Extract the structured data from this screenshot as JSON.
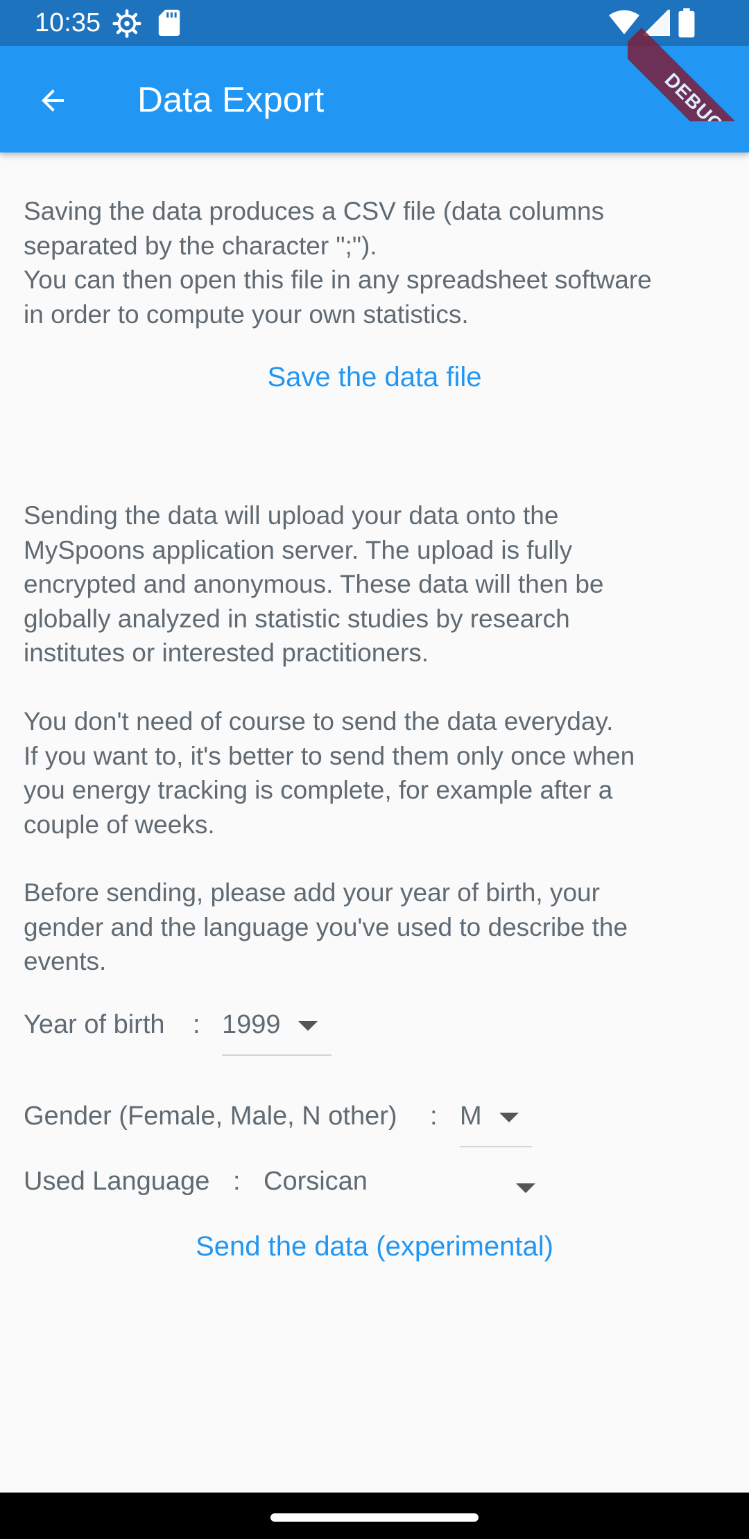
{
  "status_bar": {
    "time": "10:35",
    "icons": [
      "settings-gear-icon",
      "sd-card-icon",
      "wifi-icon",
      "signal-icon",
      "battery-icon"
    ]
  },
  "app_bar": {
    "back_icon": "arrow-back-icon",
    "title": "Data Export"
  },
  "debug_banner": "DEBUG",
  "intro": {
    "text": "Saving the data produces a CSV file (data columns\nseparated by the character \";\").\nYou can then open this file in any spreadsheet software\nin order to compute your own statistics."
  },
  "save_button": {
    "label": "Save the data file"
  },
  "sending": {
    "paragraph1": "Sending the data will upload your data onto the\nMySpoons application server. The upload is fully\nencrypted and anonymous. These data will then be\nglobally analyzed in statistic studies by research\ninstitutes or interested practitioners.",
    "paragraph2": "You don't need of course to send the data everyday.\nIf you want to, it's better to send them only once when\nyou energy tracking is complete, for example after a\ncouple of weeks.",
    "paragraph3": "Before sending, please add your year of birth, your\ngender and the language you've used to describe the\nevents."
  },
  "form": {
    "year_of_birth": {
      "label": "Year of birth",
      "separator": ":",
      "value": "1999"
    },
    "gender": {
      "label": "Gender (Female, Male, N other)",
      "separator": ":",
      "value": "M"
    },
    "language": {
      "label": "Used Language",
      "separator": ":",
      "value": "Corsican"
    }
  },
  "send_button": {
    "label": "Send the data (experimental)"
  },
  "colors": {
    "status_bar": "#1e73be",
    "app_bar": "#2196f3",
    "accent": "#2196f3",
    "body_text": "#606a72",
    "background": "#fafafa"
  }
}
